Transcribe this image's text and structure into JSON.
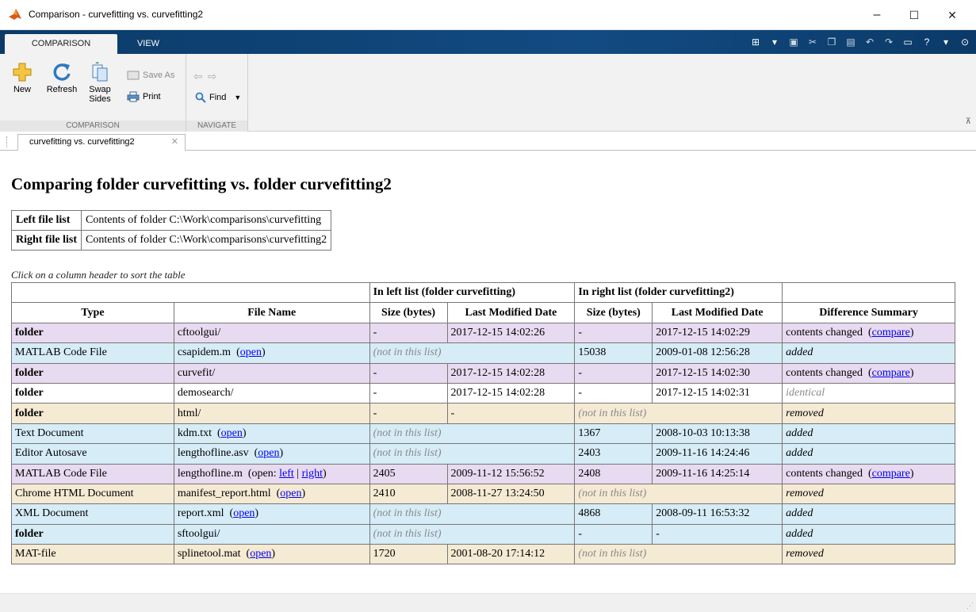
{
  "window": {
    "title": "Comparison - curvefitting vs. curvefitting2",
    "controls": [
      "–",
      "☐",
      "✕"
    ]
  },
  "ribbon_tabs": [
    {
      "label": "COMPARISON",
      "active": true
    },
    {
      "label": "VIEW",
      "active": false
    }
  ],
  "ribbon": {
    "new_label": "New",
    "refresh_label": "Refresh",
    "swap_label_1": "Swap",
    "swap_label_2": "Sides",
    "save_as_label": "Save As",
    "print_label": "Print",
    "find_label": "Find",
    "groups": {
      "comparison": "COMPARISON",
      "navigate": "NAVIGATE"
    }
  },
  "doc_tab": {
    "label": "curvefitting vs. curvefitting2"
  },
  "report": {
    "heading": "Comparing folder curvefitting vs. folder curvefitting2",
    "left_key": "Left file list",
    "left_val": "Contents of folder C:\\Work\\comparisons\\curvefitting",
    "right_key": "Right file list",
    "right_val": "Contents of folder C:\\Work\\comparisons\\curvefitting2",
    "hint": "Click on a column header to sort the table",
    "group_left": "In left list  (folder curvefitting)",
    "group_right": "In right list  (folder curvefitting2)",
    "headers": {
      "type": "Type",
      "file_name": "File Name",
      "left_size": "Size (bytes)",
      "left_date": "Last Modified Date",
      "right_size": "Size (bytes)",
      "right_date": "Last Modified Date",
      "summary": "Difference Summary"
    }
  },
  "rows": [
    {
      "type": "folder",
      "bold": true,
      "name": "cftoolgui/",
      "link": "",
      "lsize": "-",
      "ldate": "2017-12-15 14:02:26",
      "rsize": "-",
      "rdate": "2017-12-15 14:02:29",
      "summary": "contents changed",
      "summary_link": "compare",
      "status": "changed"
    },
    {
      "type": "MATLAB Code File",
      "bold": false,
      "name": "csapidem.m",
      "link": "open",
      "lsize": "(not in this list)",
      "ldate": "",
      "rsize": "15038",
      "rdate": "2009-01-08 12:56:28",
      "summary": "added",
      "summary_link": "",
      "status": "added"
    },
    {
      "type": "folder",
      "bold": true,
      "name": "curvefit/",
      "link": "",
      "lsize": "-",
      "ldate": "2017-12-15 14:02:28",
      "rsize": "-",
      "rdate": "2017-12-15 14:02:30",
      "summary": "contents changed",
      "summary_link": "compare",
      "status": "changed"
    },
    {
      "type": "folder",
      "bold": true,
      "name": "demosearch/",
      "link": "",
      "lsize": "-",
      "ldate": "2017-12-15 14:02:28",
      "rsize": "-",
      "rdate": "2017-12-15 14:02:31",
      "summary": "identical",
      "summary_link": "",
      "status": "same"
    },
    {
      "type": "folder",
      "bold": true,
      "name": "html/",
      "link": "",
      "lsize": "-",
      "ldate": "-",
      "rsize": "(not in this list)",
      "rdate": "",
      "summary": "removed",
      "summary_link": "",
      "status": "removed"
    },
    {
      "type": "Text Document",
      "bold": false,
      "name": "kdm.txt",
      "link": "open",
      "lsize": "(not in this list)",
      "ldate": "",
      "rsize": "1367",
      "rdate": "2008-10-03 10:13:38",
      "summary": "added",
      "summary_link": "",
      "status": "added"
    },
    {
      "type": "Editor Autosave",
      "bold": false,
      "name": "lengthofline.asv",
      "link": "open",
      "lsize": "(not in this list)",
      "ldate": "",
      "rsize": "2403",
      "rdate": "2009-11-16 14:24:46",
      "summary": "added",
      "summary_link": "",
      "status": "added"
    },
    {
      "type": "MATLAB Code File",
      "bold": false,
      "name": "lengthofline.m",
      "link": "",
      "open_prefix": "(open: ",
      "open_left": "left",
      "open_sep": " | ",
      "open_right": "right",
      "open_suffix": ")",
      "lsize": "2405",
      "ldate": "2009-11-12 15:56:52",
      "rsize": "2408",
      "rdate": "2009-11-16 14:25:14",
      "summary": "contents changed",
      "summary_link": "compare",
      "status": "changed"
    },
    {
      "type": "Chrome HTML Document",
      "bold": false,
      "name": "manifest_report.html",
      "link": "open",
      "lsize": "2410",
      "ldate": "2008-11-27 13:24:50",
      "rsize": "(not in this list)",
      "rdate": "",
      "summary": "removed",
      "summary_link": "",
      "status": "removed"
    },
    {
      "type": "XML Document",
      "bold": false,
      "name": "report.xml",
      "link": "open",
      "lsize": "(not in this list)",
      "ldate": "",
      "rsize": "4868",
      "rdate": "2008-09-11 16:53:32",
      "summary": "added",
      "summary_link": "",
      "status": "added"
    },
    {
      "type": "folder",
      "bold": true,
      "name": "sftoolgui/",
      "link": "",
      "lsize": "(not in this list)",
      "ldate": "",
      "rsize": "-",
      "rdate": "-",
      "summary": "added",
      "summary_link": "",
      "status": "added"
    },
    {
      "type": "MAT-file",
      "bold": false,
      "name": "splinetool.mat",
      "link": "open",
      "lsize": "1720",
      "ldate": "2001-08-20 17:14:12",
      "rsize": "(not in this list)",
      "rdate": "",
      "summary": "removed",
      "summary_link": "",
      "status": "removed"
    }
  ],
  "colors": {
    "changed": "#e8daf0",
    "added": "#d6ecf7",
    "removed": "#f5ead3",
    "ribbon_blue": "#0e3f6f"
  }
}
